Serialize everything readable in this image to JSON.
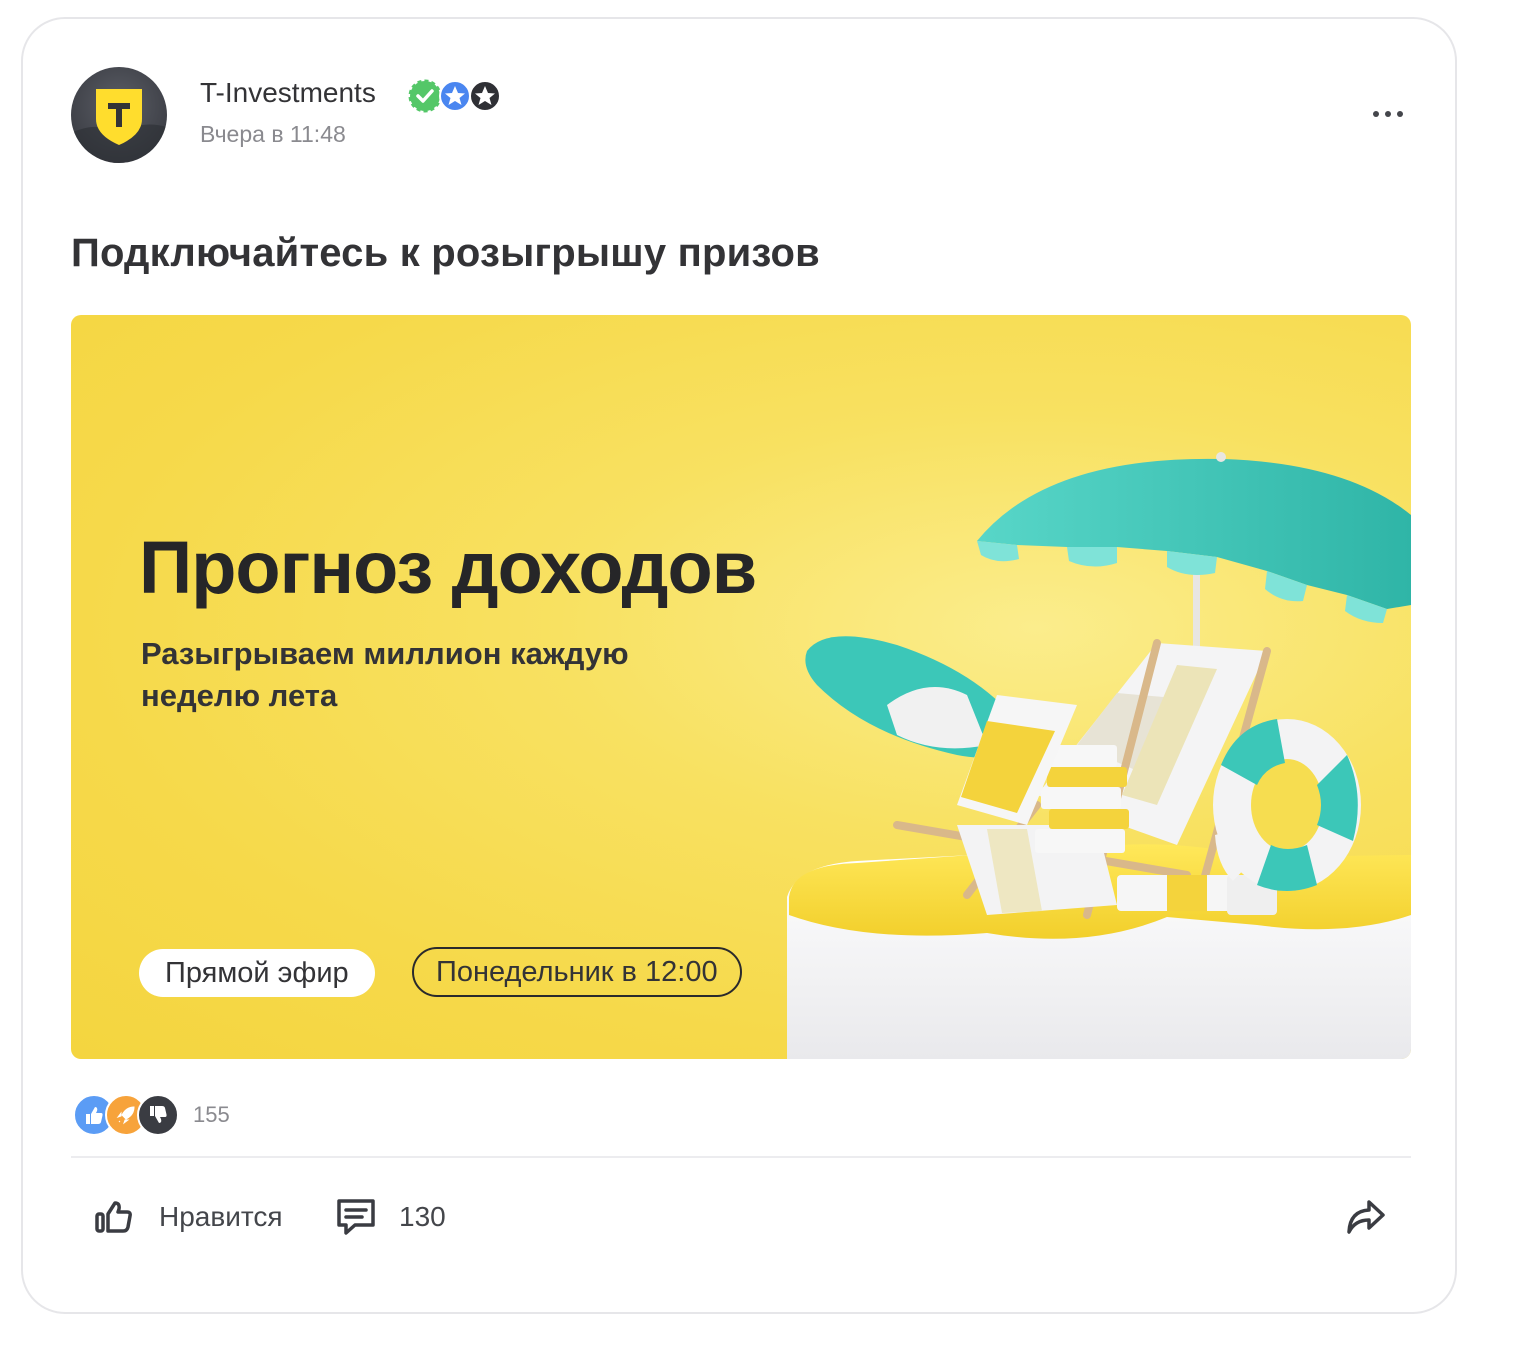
{
  "post": {
    "author": "T-Investments",
    "time": "Вчера в 11:48",
    "title": "Подключайтесь к розыгрышу призов"
  },
  "banner": {
    "headline": "Прогноз доходов",
    "subtitle": "Разыгрываем миллион каждую неделю лета",
    "pill_live": "Прямой эфир",
    "pill_time": "Понедельник в 12:00"
  },
  "reactions": {
    "count": "155",
    "icons": [
      "thumbs-up-icon",
      "rocket-icon",
      "thumbs-down-icon"
    ]
  },
  "actions": {
    "like_label": "Нравится",
    "comments_count": "130"
  },
  "colors": {
    "banner_yellow": "#f6d94a",
    "teal": "#3cc7b8",
    "text": "#333336",
    "muted": "#8a8a8f"
  }
}
